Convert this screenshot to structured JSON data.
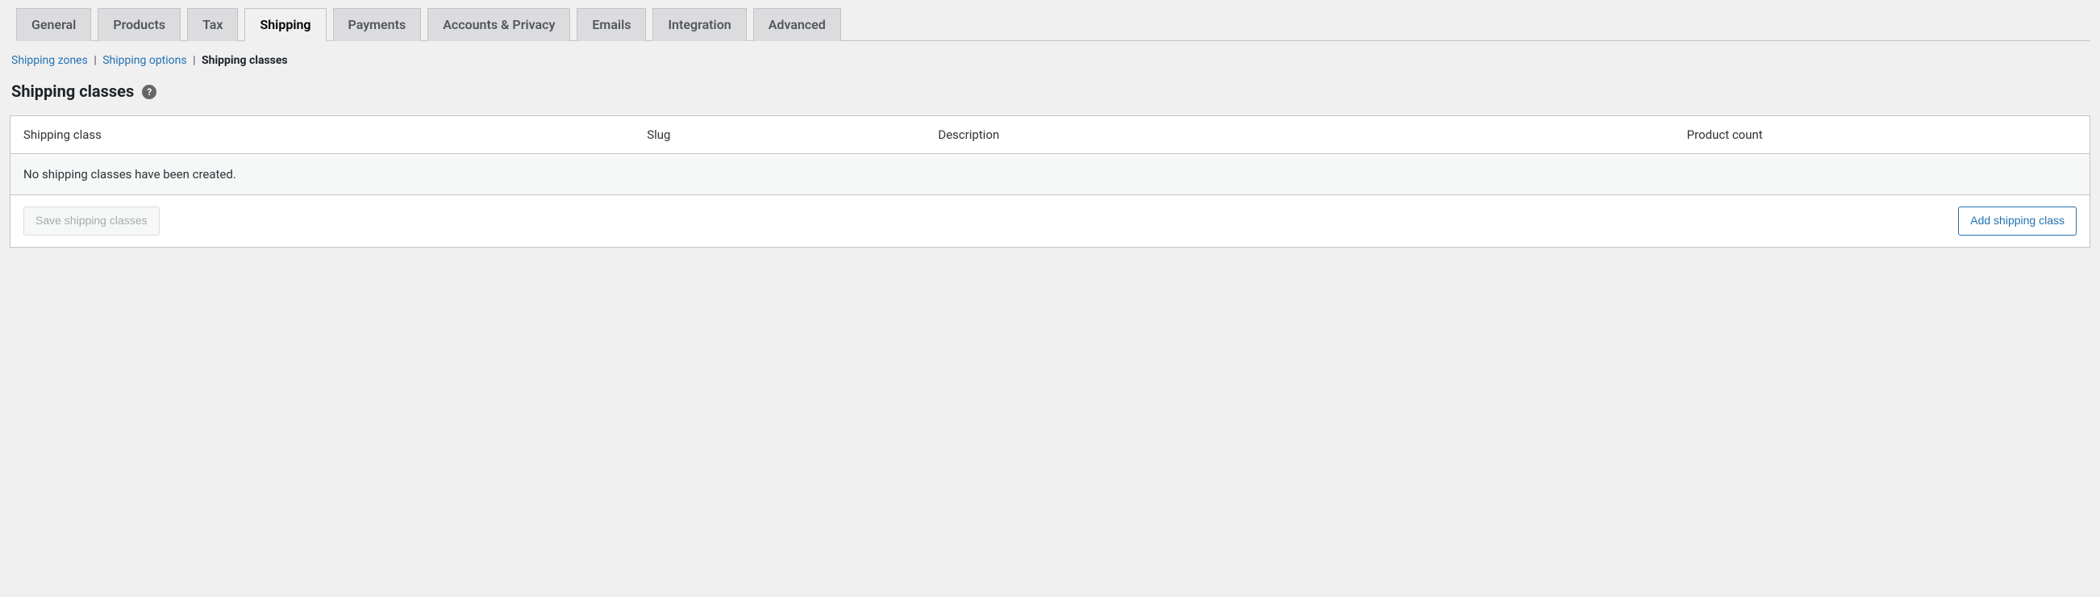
{
  "tabs": [
    {
      "label": "General"
    },
    {
      "label": "Products"
    },
    {
      "label": "Tax"
    },
    {
      "label": "Shipping",
      "active": true
    },
    {
      "label": "Payments"
    },
    {
      "label": "Accounts & Privacy"
    },
    {
      "label": "Emails"
    },
    {
      "label": "Integration"
    },
    {
      "label": "Advanced"
    }
  ],
  "subnav": {
    "zones": "Shipping zones",
    "options": "Shipping options",
    "classes": "Shipping classes",
    "sep": "|"
  },
  "heading": "Shipping classes",
  "help_glyph": "?",
  "columns": {
    "shipping_class": "Shipping class",
    "slug": "Slug",
    "description": "Description",
    "product_count": "Product count"
  },
  "empty_message": "No shipping classes have been created.",
  "buttons": {
    "save": "Save shipping classes",
    "add": "Add shipping class"
  }
}
